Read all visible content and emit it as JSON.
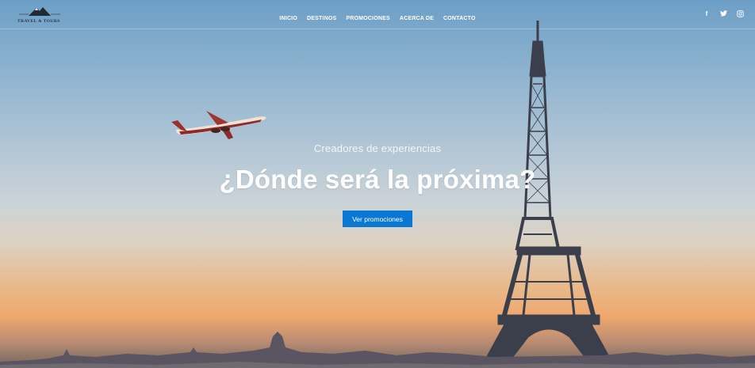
{
  "brand": {
    "name": "TRAVEL & TOURS"
  },
  "nav": {
    "items": [
      {
        "label": "INICIO"
      },
      {
        "label": "DESTINOS"
      },
      {
        "label": "PROMOCIONES"
      },
      {
        "label": "ACERCA DE"
      },
      {
        "label": "CONTACTO"
      }
    ]
  },
  "social": {
    "icons": [
      "facebook-icon",
      "twitter-icon",
      "instagram-icon"
    ],
    "facebook_glyph": "f",
    "twitter_glyph": "t",
    "instagram_glyph": "◎"
  },
  "hero": {
    "tagline": "Creadores de experiencias",
    "headline": "¿Dónde será la próxima?",
    "cta_label": "Ver promociones"
  },
  "colors": {
    "accent": "#0a78d2",
    "sky_top": "#6d9fc7",
    "sunset": "#efa86e"
  }
}
